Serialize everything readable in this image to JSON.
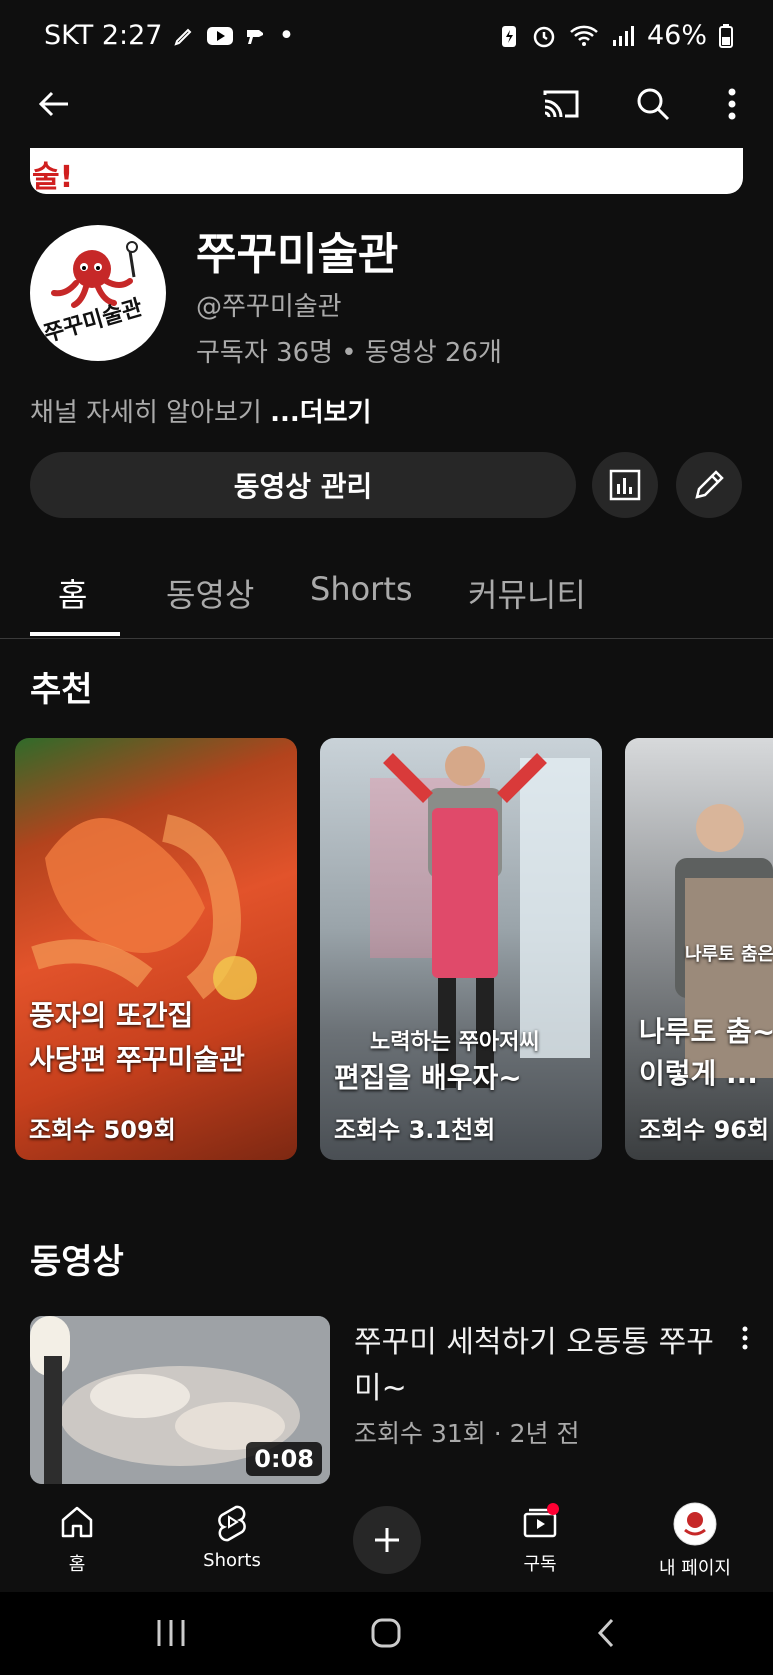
{
  "status_bar": {
    "carrier_time": "SKT 2:27",
    "dot": "•",
    "battery": "46%"
  },
  "channel": {
    "name": "쭈꾸미술관",
    "handle": "@쭈꾸미술관",
    "stats": "구독자 36명 • 동영상 26개",
    "about": "채널 자세히 알아보기",
    "about_more": "...더보기",
    "avatar_logo_text": "쭈꾸미술관",
    "banner_text": "술!"
  },
  "actions": {
    "manage_label": "동영상 관리"
  },
  "tabs": [
    {
      "label": "홈",
      "active": true
    },
    {
      "label": "동영상"
    },
    {
      "label": "Shorts"
    },
    {
      "label": "커뮤니티"
    }
  ],
  "recommended": {
    "title": "추천",
    "items": [
      {
        "line1": "풍자의 또간집",
        "line2": "사당편 쭈꾸미술관",
        "views": "조회수 509회",
        "overlay": ""
      },
      {
        "line1": "",
        "line2": "편집을 배우자~",
        "views": "조회수 3.1천회",
        "overlay": "노력하는 쭈아저씨"
      },
      {
        "line1": "나루토 춤~",
        "line2": "이렇게 ...",
        "views": "조회수 96회",
        "overlay": "나루토 춤은"
      }
    ]
  },
  "videos": {
    "title": "동영상",
    "items": [
      {
        "title": "쭈꾸미 세척하기 오동통 쭈꾸미~",
        "meta": "조회수 31회 · 2년 전",
        "duration": "0:08"
      }
    ]
  },
  "bottom_nav": [
    {
      "label": "홈"
    },
    {
      "label": "Shorts"
    },
    {
      "label": ""
    },
    {
      "label": "구독"
    },
    {
      "label": "내 페이지"
    }
  ],
  "colors": {
    "background": "#0f0f0f",
    "chip": "#272727",
    "notification": "#ff0033",
    "accent_red": "#d01f1f"
  }
}
